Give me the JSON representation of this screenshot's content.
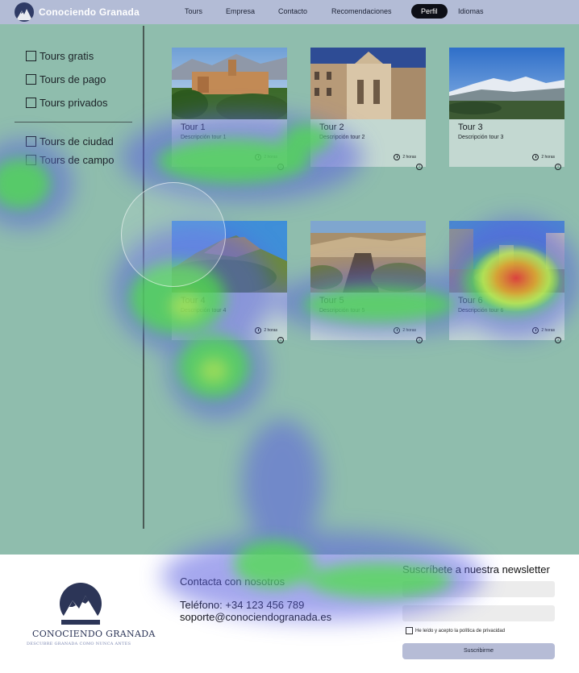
{
  "nav": {
    "brand": "Conociendo Granada",
    "links": [
      "Tours",
      "Empresa",
      "Contacto",
      "Recomendaciones",
      "Perfil",
      "Idiomas"
    ],
    "active": "Perfil"
  },
  "filters": {
    "group1": [
      "Tours gratis",
      "Tours de pago",
      "Tours privados"
    ],
    "group2": [
      "Tours de ciudad",
      "Tours de campo"
    ]
  },
  "tours": [
    {
      "title": "Tour 1",
      "desc": "Descripción tour 1",
      "duration": "2 horas"
    },
    {
      "title": "Tour 2",
      "desc": "Descripción tour 2",
      "duration": "2 horas"
    },
    {
      "title": "Tour 3",
      "desc": "Descripción tour 3",
      "duration": "2 horas"
    },
    {
      "title": "Tour 4",
      "desc": "Descripción tour 4",
      "duration": "2 horas"
    },
    {
      "title": "Tour 5",
      "desc": "Descripción tour 5",
      "duration": "2 horas"
    },
    {
      "title": "Tour 6",
      "desc": "Descripción tour 6",
      "duration": "2 horas"
    }
  ],
  "footer": {
    "brand_name": "CONOCIENDO GRANADA",
    "tagline": "DESCUBRE GRANADA COMO NUNCA ANTES",
    "contact_title": "Contacta con nosotros",
    "phone": "Teléfono: +34 123 456 789",
    "email": "soporte@conociendogranada.es",
    "newsletter_title": "Suscríbete a nuestra newsletter",
    "consent": "He leído y acepto la política de privacidad",
    "submit": "Suscribirme"
  },
  "colors": {
    "nav_bg": "#b3bcd6",
    "main_bg": "#8fbdad",
    "card_bg": "#c3d8d1",
    "active_pill": "#0d0f17",
    "brand_navy": "#2c3557"
  },
  "overlay": "eye-tracking heatmap"
}
